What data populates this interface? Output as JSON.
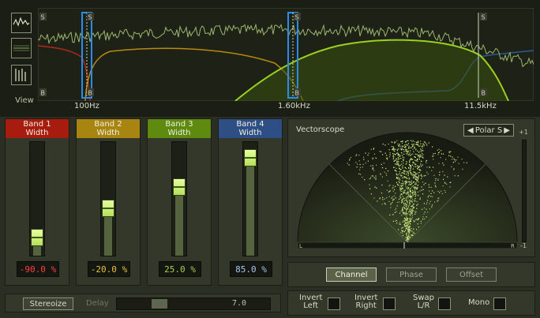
{
  "spectrum": {
    "view_label": "View",
    "freq_labels": [
      "100Hz",
      "1.60kHz",
      "11.5kHz"
    ],
    "marker_solo": "S",
    "marker_bypass": "B",
    "colors": {
      "band1": "#b02818",
      "band2": "#b88a10",
      "band3": "#9ad020",
      "band4": "#2a5a98",
      "spectrum": "#a8c878"
    }
  },
  "bands": [
    {
      "name": "Band 1",
      "param": "Width",
      "value": "-90.0",
      "unit": "%",
      "level": 0.1,
      "color": "#a81c10",
      "value_color": "#ff4040"
    },
    {
      "name": "Band 2",
      "param": "Width",
      "value": "-20.0",
      "unit": "%",
      "level": 0.4,
      "color": "#a88410",
      "value_color": "#e8c040"
    },
    {
      "name": "Band 3",
      "param": "Width",
      "value": "25.0",
      "unit": "%",
      "level": 0.625,
      "color": "#5e8a10",
      "value_color": "#a8d050"
    },
    {
      "name": "Band 4",
      "param": "Width",
      "value": "85.0",
      "unit": "%",
      "level": 0.925,
      "color": "#2d4f86",
      "value_color": "#a8c8f0"
    }
  ],
  "stereoize": {
    "button_label": "Stereoize",
    "delay_label": "Delay",
    "delay_value": "7.0"
  },
  "vectorscope": {
    "title": "Vectorscope",
    "mode": "Polar S",
    "scale_top": "+1",
    "scale_bottom": "-1",
    "left_label": "L",
    "right_label": "R"
  },
  "modes": [
    {
      "label": "Channel",
      "active": true
    },
    {
      "label": "Phase",
      "active": false
    },
    {
      "label": "Offset",
      "active": false
    }
  ],
  "checks": [
    {
      "label_line1": "Invert",
      "label_line2": "Left"
    },
    {
      "label_line1": "Invert",
      "label_line2": "Right"
    },
    {
      "label_line1": "Swap",
      "label_line2": "L/R"
    },
    {
      "label_line1": "Mono",
      "label_line2": ""
    }
  ]
}
